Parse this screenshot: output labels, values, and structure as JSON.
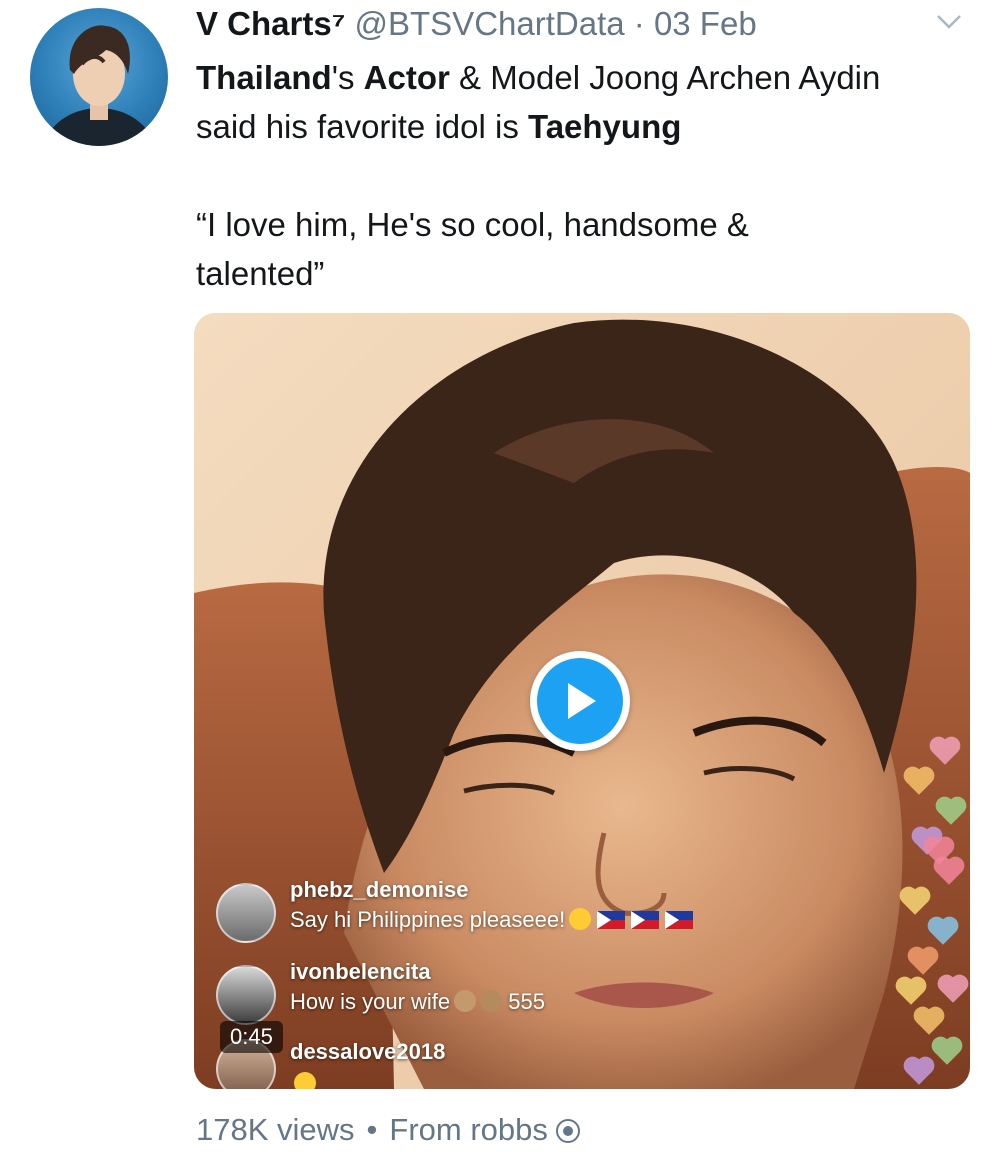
{
  "tweet": {
    "author_name": "V Charts⁷",
    "handle": "@BTSVChartData",
    "separator": "·",
    "date": "03 Feb",
    "text": {
      "line1_bold_a": "Thailand",
      "line1_a": "'s ",
      "line1_bold_b": "Actor",
      "line1_b": " & Model Joong Archen Aydin",
      "line2_a": "said his favorite idol is ",
      "line2_bold": "Taehyung",
      "line3": "“I love him, He's so cool, handsome &",
      "line4": "talented”"
    }
  },
  "video": {
    "duration": "0:45",
    "comments": [
      {
        "user": "phebz_demonise",
        "message": "Say hi Philippines pleaseee!"
      },
      {
        "user": "ivonbelencita",
        "message_a": "How is your wife",
        "message_b": "555"
      },
      {
        "user": "dessalove2018"
      }
    ]
  },
  "footer": {
    "views": "178K views",
    "separator": "•",
    "source": "From robbs"
  },
  "colors": {
    "accent": "#1da1f2",
    "muted": "#657786",
    "text": "#14171a"
  },
  "icons": [
    "chevron-down-icon",
    "play-icon",
    "verified-source-icon",
    "flag-philippines-icon"
  ]
}
